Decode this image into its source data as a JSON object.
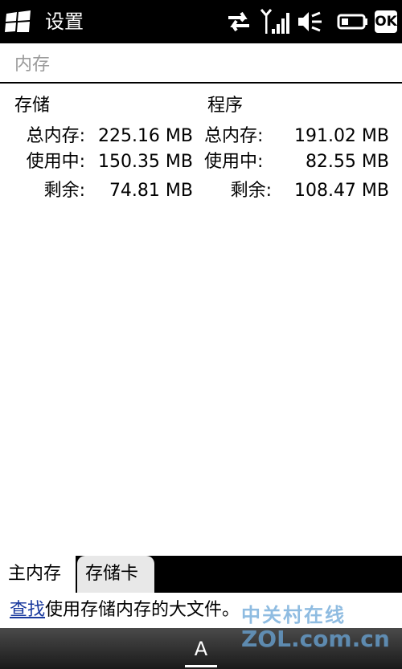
{
  "statusbar": {
    "title": "设置",
    "ok_label": "OK",
    "icons": [
      "windows-start-icon",
      "data-transfer-icon",
      "signal-strength-icon",
      "speaker-muted-icon",
      "battery-icon"
    ]
  },
  "page": {
    "title": "内存"
  },
  "storage": {
    "heading": "存储",
    "total_label": "总内存:",
    "total_value": "225.16 MB",
    "used_label": "使用中:",
    "used_value": "150.35 MB",
    "free_label": "剩余:",
    "free_value": "74.81 MB"
  },
  "program": {
    "heading": "程序",
    "total_label": "总内存:",
    "total_value": "191.02 MB",
    "used_label": "使用中:",
    "used_value": "82.55 MB",
    "free_label": "剩余:",
    "free_value": "108.47 MB"
  },
  "tabs": [
    {
      "label": "主内存",
      "active": true
    },
    {
      "label": "存储卡",
      "active": false
    }
  ],
  "link": {
    "link_label": "查找",
    "rest": "使用存储内存的大文件。"
  },
  "softbar": {
    "keyboard_label": "A"
  },
  "watermark": {
    "line1": "中关村在线",
    "line2": "ZOL.com.cn"
  }
}
